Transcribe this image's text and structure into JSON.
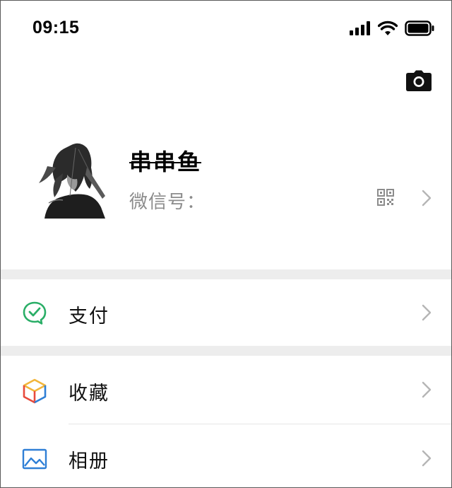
{
  "status_bar": {
    "time": "09:15"
  },
  "profile": {
    "nickname": "串串鱼",
    "wechat_id_label": "微信号："
  },
  "menu": {
    "items": [
      {
        "label": "支付",
        "icon": "wechat-pay-icon",
        "color": "#2aae67"
      },
      {
        "label": "收藏",
        "icon": "favorites-cube-icon",
        "color": "#f2b53a"
      },
      {
        "label": "相册",
        "icon": "album-icon",
        "color": "#2f7fd6"
      }
    ]
  },
  "colors": {
    "separator": "#ededed",
    "secondary_text": "#8c8c8c",
    "chevron": "#b5b5b5"
  }
}
